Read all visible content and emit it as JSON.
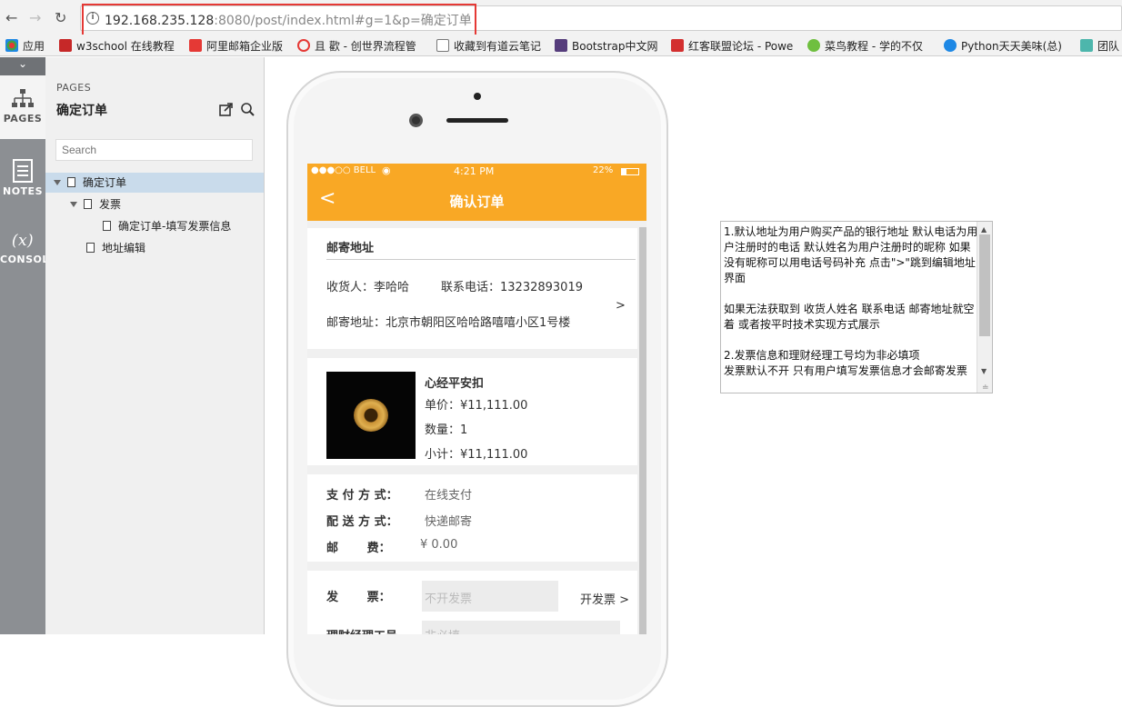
{
  "browser": {
    "url_host": "192.168.235.128",
    "url_rest": ":8080/post/index.html#g=1&p=确定订单",
    "bookmarks": [
      {
        "label": "应用",
        "color": "#e57373"
      },
      {
        "label": "w3school 在线教程",
        "color": "#c62828"
      },
      {
        "label": "阿里邮箱企业版",
        "color": "#e53935"
      },
      {
        "label": "且 歡 - 创世界流程管",
        "color": "#e53935"
      },
      {
        "label": "收藏到有道云笔记",
        "color": "#ffffff"
      },
      {
        "label": "Bootstrap中文网",
        "color": "#563d7c"
      },
      {
        "label": "红客联盟论坛 - Powe",
        "color": "#d32f2f"
      },
      {
        "label": "菜鸟教程 - 学的不仅",
        "color": "#6fbf3f"
      },
      {
        "label": "Python天天美味(总)",
        "color": "#1e88e5"
      },
      {
        "label": "团队",
        "color": "#4db6ac"
      }
    ]
  },
  "rail": {
    "items": [
      {
        "label": "PAGES",
        "icon": "sitemap-icon"
      },
      {
        "label": "NOTES",
        "icon": "notes-icon"
      },
      {
        "label": "CONSOL",
        "icon": "variable-icon",
        "glyph": "(x)"
      }
    ]
  },
  "pages_panel": {
    "heading": "PAGES",
    "title": "确定订单",
    "search_placeholder": "Search",
    "tree": [
      {
        "label": "确定订单"
      },
      {
        "label": "发票"
      },
      {
        "label": "确定订单-填写发票信息"
      },
      {
        "label": "地址编辑"
      }
    ]
  },
  "phone": {
    "status": {
      "carrier": "●●●○○ BELL",
      "time": "4:21 PM",
      "battery": "22%"
    },
    "title": "确认订单",
    "back": "<",
    "address": {
      "heading": "邮寄地址",
      "receiver": "收货人：李哈哈",
      "phone": "联系电话：13232893019",
      "addr": "邮寄地址：北京市朝阳区哈哈路嘻嘻小区1号楼",
      "arrow": ">"
    },
    "product": {
      "name": "心经平安扣",
      "price": "单价：¥11,111.00",
      "qty": "数量：1",
      "subtotal": "小计：¥11,111.00"
    },
    "payment": {
      "pay_label": "支 付 方 式：",
      "pay_value": "在线支付",
      "ship_label": "配 送 方 式：",
      "ship_value": "快递邮寄",
      "fee_label": "邮       费：",
      "fee_value": "¥ 0.00"
    },
    "invoice": {
      "label": "发       票：",
      "placeholder": "不开发票",
      "link": "开发票 >",
      "manager_label": "理财经理工号",
      "manager_placeholder": "非必填"
    }
  },
  "notes": {
    "text": "1.默认地址为用户购买产品的银行地址 默认电话为用户注册时的电话 默认姓名为用户注册时的昵称 如果没有昵称可以用电话号码补充 点击\">\"跳到编辑地址界面\n\n如果无法获取到 收货人姓名 联系电话 邮寄地址就空着 或者按平时技术实现方式展示\n\n2.发票信息和理财经理工号均为非必填项\n发票默认不开 只有用户填写发票信息才会邮寄发票"
  }
}
